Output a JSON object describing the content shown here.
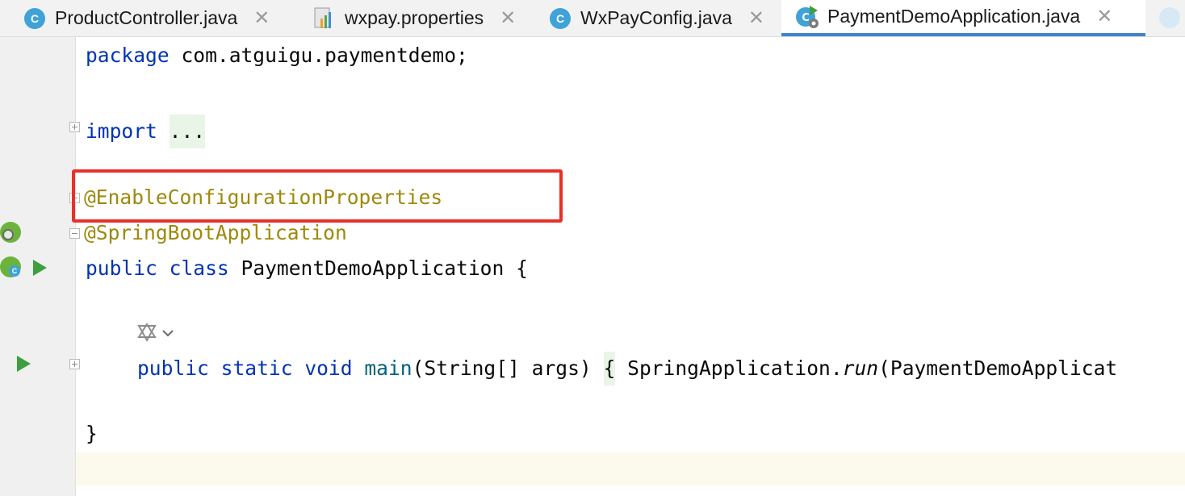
{
  "tabs": [
    {
      "label": "ProductController.java",
      "icon": "java-class-icon",
      "active": false
    },
    {
      "label": "wxpay.properties",
      "icon": "properties-file-icon",
      "active": false
    },
    {
      "label": "WxPayConfig.java",
      "icon": "java-class-icon",
      "active": false
    },
    {
      "label": "PaymentDemoApplication.java",
      "icon": "spring-boot-class-icon",
      "active": true
    }
  ],
  "tab_close_glyph": "✕",
  "class_icon_letter": "C",
  "code": {
    "line1_kw": "package",
    "line1_rest": " com.atguigu.paymentdemo;",
    "line2_kw": "import",
    "line2_fold": "...",
    "line3_ann": "@EnableConfigurationProperties",
    "line4_ann": "@SpringBootApplication",
    "line5_kw1": "public",
    "line5_kw2": "class",
    "line5_rest": " PaymentDemoApplication {",
    "line6_kw1": "public",
    "line6_kw2": "static",
    "line6_kw3": "void",
    "line6_fn": "main",
    "line6_args": "(String[] args) ",
    "line6_brace": "{",
    "line6_call": " SpringApplication.",
    "line6_run": "run",
    "line6_tail": "(PaymentDemoApplicat",
    "line7": "}"
  },
  "colors": {
    "keyword": "#0033b3",
    "annotation": "#9e880d",
    "method": "#00627a",
    "highlight_box": "#e8302b",
    "run_gutter": "#3e9f3e",
    "active_tab_underline": "#4083c9"
  }
}
